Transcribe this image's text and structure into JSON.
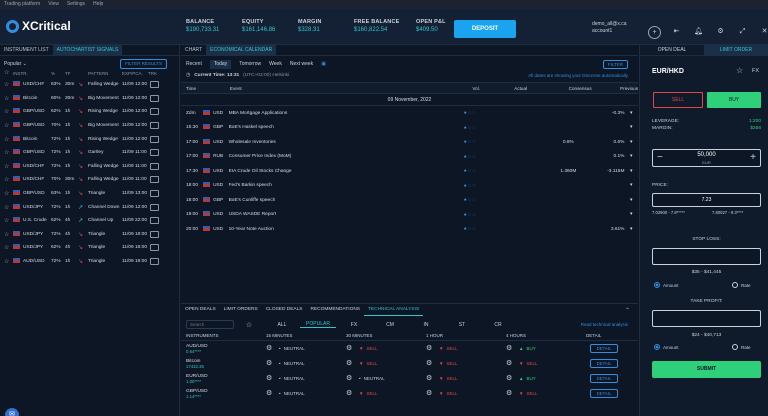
{
  "menubar": {
    "items": [
      "Trading platform",
      "View",
      "Settings",
      "Help"
    ]
  },
  "header": {
    "logo": "XCritical",
    "stats": [
      {
        "label": "BALANCE",
        "value": "$190,733.31"
      },
      {
        "label": "EQUITY",
        "value": "$161,146.86"
      },
      {
        "label": "MARGIN",
        "value": "$328.31"
      },
      {
        "label": "FREE BALANCE",
        "value": "$160,822.54"
      },
      {
        "label": "OPEN P&L",
        "value": "$409.50"
      }
    ],
    "deposit_label": "DEPOSIT",
    "user_email": "demo_all@x.ca",
    "user_account": "account1",
    "icons": [
      "plus-circle-icon",
      "back-icon",
      "bell-icon",
      "gear-icon",
      "fullscreen-icon",
      "close-icon"
    ]
  },
  "left": {
    "tabs": [
      "INSTRUMENT LIST",
      "AUTOCHARTIST SIGNALS"
    ],
    "filter_label": "Popular",
    "filter_button": "FILTER RESULTS",
    "columns": [
      "INSTR.",
      "%",
      "TF",
      "",
      "PATTERN",
      "EXP/PCA.",
      "TRK"
    ],
    "rows": [
      {
        "sym": "USD/CHF",
        "pct": "63%",
        "tf": "30m",
        "dir": "down",
        "pattern": "Falling Wedge",
        "exp": "11/09 12:00"
      },
      {
        "sym": "Bitcoin",
        "pct": "60%",
        "tf": "30m",
        "dir": "down",
        "pattern": "Big Movement",
        "exp": "11/09 12:00"
      },
      {
        "sym": "GBP/USD",
        "pct": "62%",
        "tf": "1h",
        "dir": "down",
        "pattern": "Rising Wedge",
        "exp": "11/09 12:00"
      },
      {
        "sym": "GBP/USD",
        "pct": "70%",
        "tf": "1h",
        "dir": "down",
        "pattern": "Big Movement",
        "exp": "11/09 12:00"
      },
      {
        "sym": "Bitcoin",
        "pct": "72%",
        "tf": "1h",
        "dir": "down",
        "pattern": "Rising Wedge",
        "exp": "11/09 12:00"
      },
      {
        "sym": "GBP/USD",
        "pct": "72%",
        "tf": "1h",
        "dir": "down",
        "pattern": "Gartley",
        "exp": "11/09 11:00"
      },
      {
        "sym": "USD/CHF",
        "pct": "72%",
        "tf": "1h",
        "dir": "down",
        "pattern": "Falling Wedge",
        "exp": "11/09 11:00"
      },
      {
        "sym": "USD/CHF",
        "pct": "70%",
        "tf": "30m",
        "dir": "down",
        "pattern": "Falling Wedge",
        "exp": "11/09 11:00"
      },
      {
        "sym": "GBP/USD",
        "pct": "63%",
        "tf": "1h",
        "dir": "down",
        "pattern": "Triangle",
        "exp": "11/09 13:00"
      },
      {
        "sym": "USD/JPY",
        "pct": "72%",
        "tf": "1h",
        "dir": "up",
        "pattern": "Channel Down",
        "exp": "11/09 12:00"
      },
      {
        "sym": "U.S. Crude",
        "pct": "62%",
        "tf": "4h",
        "dir": "up",
        "pattern": "Channel Up",
        "exp": "11/09 22:00"
      },
      {
        "sym": "USD/JPY",
        "pct": "72%",
        "tf": "4h",
        "dir": "down",
        "pattern": "Triangle",
        "exp": "11/09 18:00"
      },
      {
        "sym": "USD/JPY",
        "pct": "62%",
        "tf": "4h",
        "dir": "down",
        "pattern": "Triangle",
        "exp": "11/09 18:00"
      },
      {
        "sym": "AUD/USD",
        "pct": "72%",
        "tf": "1h",
        "dir": "down",
        "pattern": "Triangle",
        "exp": "11/09 18:00"
      }
    ]
  },
  "center": {
    "tabs": [
      "CHART",
      "ECONOMICAL CALENDAR"
    ],
    "subtabs": [
      "Recent",
      "Today",
      "Tomorrow",
      "Week",
      "Next week"
    ],
    "filter_button": "FILTER",
    "current_time_label": "Current Time: 13:31",
    "timezone": "(UTC+02:00) Helsinki",
    "timebar_link": "All dates are showing your timezone automatically",
    "columns": [
      "Time",
      "Event",
      "Vol.",
      "Actual",
      "Consensus",
      "Previous"
    ],
    "date_header": "09 November, 2022",
    "events": [
      {
        "time": "Zdm",
        "cur": "USD",
        "event": "MBA Mortgage Applications",
        "vol": "● ◌ ◌",
        "actual": "",
        "cons": "",
        "prev": "-0.3%"
      },
      {
        "time": "15:30",
        "cur": "GBP",
        "event": "BoE's Haskel speech",
        "vol": "● ◌ ◌",
        "actual": "",
        "cons": "",
        "prev": ""
      },
      {
        "time": "17:00",
        "cur": "USD",
        "event": "Wholesale Inventories",
        "vol": "● ◌ ◌",
        "actual": "",
        "cons": "0.8%",
        "prev": "0.6%"
      },
      {
        "time": "17:00",
        "cur": "RUB",
        "event": "Consumer Price Index (MoM)",
        "vol": "● ◌ ◌",
        "actual": "",
        "cons": "",
        "prev": "0.1%"
      },
      {
        "time": "17:30",
        "cur": "USD",
        "event": "EIA Crude Oil Stocks Change",
        "vol": "● ◌ ◌",
        "actual": "",
        "cons": "1.360M",
        "prev": "-3.115M"
      },
      {
        "time": "18:00",
        "cur": "USD",
        "event": "Fed's Barkin speech",
        "vol": "● ◌ ◌",
        "actual": "",
        "cons": "",
        "prev": ""
      },
      {
        "time": "18:00",
        "cur": "GBP",
        "event": "BoE's Cunliffe speech",
        "vol": "● ◌ ◌",
        "actual": "",
        "cons": "",
        "prev": ""
      },
      {
        "time": "19:00",
        "cur": "USD",
        "event": "USDA WASDE Report",
        "vol": "● ◌ ◌",
        "actual": "",
        "cons": "",
        "prev": ""
      },
      {
        "time": "20:00",
        "cur": "USD",
        "event": "10-Year Note Auction",
        "vol": "● ◌ ◌",
        "actual": "",
        "cons": "",
        "prev": "3.61%"
      }
    ],
    "bottom_tabs": [
      "OPEN DEALS",
      "LIMIT ORDERS",
      "CLOSED DEALS",
      "RECOMMENDATIONS",
      "TECHNICAL ANALYSIS"
    ],
    "search_placeholder": "Search",
    "ta_filters": [
      "ALL",
      "POPULAR",
      "FX",
      "CM",
      "IN",
      "ST",
      "CR"
    ],
    "ta_link": "Read technical analysis",
    "ta_columns": [
      "INSTRUMENTS",
      "15 MINUTES",
      "30 MINUTES",
      "1 HOUR",
      "4 HOURS",
      "DETAIL"
    ],
    "ta_rows": [
      {
        "sym": "AUD/USD",
        "price": "0.64****",
        "s15": "NEUTRAL",
        "s30": "SELL",
        "s1h": "SELL",
        "s4h": "BUY",
        "detail": "DETAIL"
      },
      {
        "sym": "Bitcoin",
        "price": "17432.35",
        "s15": "NEUTRAL",
        "s30": "SELL",
        "s1h": "SELL",
        "s4h": "SELL",
        "detail": "DETAIL"
      },
      {
        "sym": "EUR/USD",
        "price": "1.00****",
        "s15": "NEUTRAL",
        "s30": "NEUTRAL",
        "s1h": "SELL",
        "s4h": "BUY",
        "detail": "DETAIL"
      },
      {
        "sym": "GBP/USD",
        "price": "1.14****",
        "s15": "NEUTRAL",
        "s30": "SELL",
        "s1h": "SELL",
        "s4h": "SELL",
        "detail": "DETAIL"
      }
    ]
  },
  "right": {
    "tabs": [
      "OPEN DEAL",
      "LIMIT ORDER"
    ],
    "pair": "EUR/HKD",
    "fx": "FX",
    "sell": "SELL",
    "buy": "BUY",
    "leverage_label": "LEVERAGE:",
    "leverage": "1:200",
    "margin_label": "MARGIN:",
    "margin": "$258",
    "amount": "50,000",
    "amount_unit": "EUR",
    "price_label": "PRICE:",
    "price": "7.23",
    "range_low": "7.02900 - 7.8*****",
    "range_high": "7.80027 - 9.3****",
    "stop_loss": "STOP LOSS:",
    "sl_amount": "$35 - $41,445",
    "take_profit": "TAKE PROFIT:",
    "tp_amount": "$24 - $40,713",
    "radio_amount": "Amount",
    "radio_rate": "Rate",
    "submit": "SUBMIT"
  }
}
